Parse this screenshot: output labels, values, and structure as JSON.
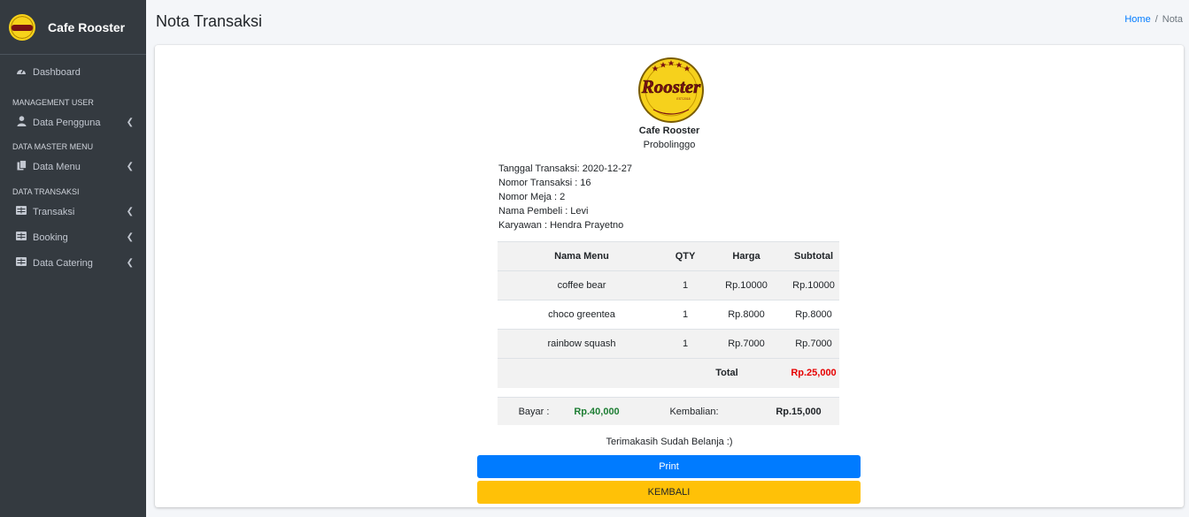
{
  "brand": {
    "name": "Cafe Rooster",
    "logo_icon": "rooster-logo-icon"
  },
  "sidebar": {
    "dashboard": {
      "label": "Dashboard",
      "icon": "dashboard-icon"
    },
    "sections": [
      {
        "header": "MANAGEMENT USER",
        "items": [
          {
            "label": "Data Pengguna",
            "icon": "user-icon"
          }
        ]
      },
      {
        "header": "DATA MASTER MENU",
        "items": [
          {
            "label": "Data Menu",
            "icon": "copy-icon"
          }
        ]
      },
      {
        "header": "DATA TRANSAKSI",
        "items": [
          {
            "label": "Transaksi",
            "icon": "table-icon"
          },
          {
            "label": "Booking",
            "icon": "table-icon"
          },
          {
            "label": "Data Catering",
            "icon": "table-icon"
          }
        ]
      }
    ]
  },
  "header": {
    "title": "Nota Transaksi",
    "breadcrumb": {
      "home": "Home",
      "separator": "/",
      "current": "Nota"
    }
  },
  "receipt": {
    "store_name": "Cafe Rooster",
    "store_city": "Probolinggo",
    "logo_text": "Rooster",
    "logo_est": "EST.2018",
    "info": [
      "Tanggal Transaksi: 2020-12-27",
      "Nomor Transaksi : 16",
      "Nomor Meja : 2",
      "Nama Pembeli : Levi",
      "Karyawan : Hendra Prayetno"
    ],
    "table": {
      "headers": [
        "Nama Menu",
        "QTY",
        "Harga",
        "Subtotal"
      ],
      "rows": [
        [
          "coffee bear",
          "1",
          "Rp.10000",
          "Rp.10000"
        ],
        [
          "choco greentea",
          "1",
          "Rp.8000",
          "Rp.8000"
        ],
        [
          "rainbow squash",
          "1",
          "Rp.7000",
          "Rp.7000"
        ]
      ],
      "total_label": "Total",
      "total_value": "Rp.25,000"
    },
    "payment": {
      "bayar_label": "Bayar :",
      "bayar_value": "Rp.40,000",
      "kembalian_label": "Kembalian:",
      "kembalian_value": "Rp.15,000"
    },
    "thanks": "Terimakasih Sudah Belanja :)",
    "print_button": "Print",
    "back_button": "KEMBALI"
  },
  "colors": {
    "sidebar_bg": "#343a40",
    "primary": "#007bff",
    "warning": "#ffc107",
    "total_red": "#e60000",
    "bayar_green": "#1e7e34"
  }
}
